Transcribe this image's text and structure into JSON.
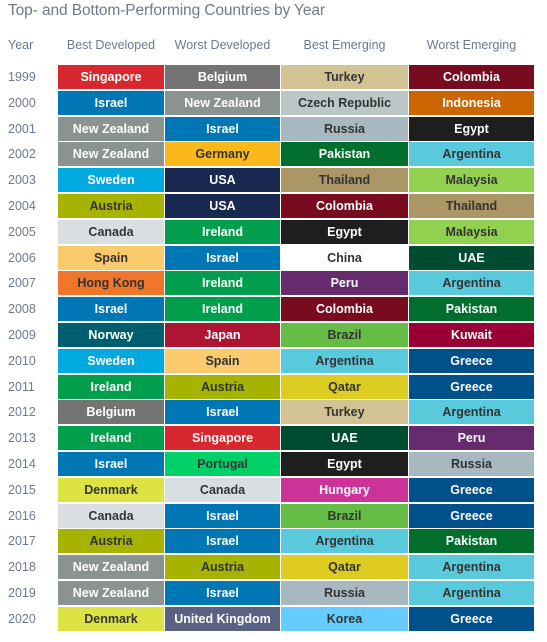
{
  "title": "Top- and Bottom-Performing Countries by Year",
  "headers": [
    "Year",
    "Best Developed",
    "Worst Developed",
    "Best Emerging",
    "Worst Emerging"
  ],
  "country_colors": {
    "Singapore": {
      "bg": "#d8282f",
      "fg": "#ffffff"
    },
    "Belgium": {
      "bg": "#747474",
      "fg": "#ffffff"
    },
    "Turkey": {
      "bg": "#d1c393",
      "fg": "#333333"
    },
    "Colombia": {
      "bg": "#780c1e",
      "fg": "#ffffff"
    },
    "Israel": {
      "bg": "#0077b5",
      "fg": "#ffffff"
    },
    "New Zealand": {
      "bg": "#8a9391",
      "fg": "#ffffff"
    },
    "Czech Republic": {
      "bg": "#b9c7c6",
      "fg": "#333333"
    },
    "Indonesia": {
      "bg": "#cc6600",
      "fg": "#ffffff"
    },
    "Russia": {
      "bg": "#a8b8c1",
      "fg": "#333333"
    },
    "Egypt": {
      "bg": "#1e1e1e",
      "fg": "#ffffff"
    },
    "Germany": {
      "bg": "#fbb81b",
      "fg": "#333333"
    },
    "Pakistan": {
      "bg": "#006f2e",
      "fg": "#ffffff"
    },
    "Argentina": {
      "bg": "#59c9dc",
      "fg": "#333333"
    },
    "Sweden": {
      "bg": "#00a9e0",
      "fg": "#ffffff"
    },
    "USA": {
      "bg": "#18284f",
      "fg": "#ffffff"
    },
    "Thailand": {
      "bg": "#ab9666",
      "fg": "#333333"
    },
    "Malaysia": {
      "bg": "#92d050",
      "fg": "#333333"
    },
    "Austria": {
      "bg": "#a6b300",
      "fg": "#333333"
    },
    "Canada": {
      "bg": "#d9dfe0",
      "fg": "#333333"
    },
    "Ireland": {
      "bg": "#009e4d",
      "fg": "#ffffff"
    },
    "Spain": {
      "bg": "#f9cb6c",
      "fg": "#333333"
    },
    "China": {
      "bg": "#ffffff",
      "fg": "#333333"
    },
    "UAE": {
      "bg": "#004c31",
      "fg": "#ffffff"
    },
    "Hong Kong": {
      "bg": "#ef762a",
      "fg": "#333333"
    },
    "Peru": {
      "bg": "#652b6d",
      "fg": "#ffffff"
    },
    "Norway": {
      "bg": "#005f6e",
      "fg": "#ffffff"
    },
    "Japan": {
      "bg": "#ad1530",
      "fg": "#ffffff"
    },
    "Brazil": {
      "bg": "#66bd45",
      "fg": "#333333"
    },
    "Kuwait": {
      "bg": "#990033",
      "fg": "#ffffff"
    },
    "Greece": {
      "bg": "#00508c",
      "fg": "#ffffff"
    },
    "Qatar": {
      "bg": "#ddcc22",
      "fg": "#333333"
    },
    "Portugal": {
      "bg": "#00d068",
      "fg": "#333333"
    },
    "Denmark": {
      "bg": "#dde343",
      "fg": "#333333"
    },
    "Hungary": {
      "bg": "#cc3399",
      "fg": "#ffffff"
    },
    "United Kingdom": {
      "bg": "#5a6283",
      "fg": "#ffffff"
    },
    "Korea": {
      "bg": "#66ccff",
      "fg": "#333333"
    }
  },
  "rows": [
    {
      "year": "1999",
      "cells": [
        "Singapore",
        "Belgium",
        "Turkey",
        "Colombia"
      ]
    },
    {
      "year": "2000",
      "cells": [
        "Israel",
        "New Zealand",
        "Czech Republic",
        "Indonesia"
      ]
    },
    {
      "year": "2001",
      "cells": [
        "New Zealand",
        "Israel",
        "Russia",
        "Egypt"
      ]
    },
    {
      "year": "2002",
      "cells": [
        "New Zealand",
        "Germany",
        "Pakistan",
        "Argentina"
      ]
    },
    {
      "year": "2003",
      "cells": [
        "Sweden",
        "USA",
        "Thailand",
        "Malaysia"
      ]
    },
    {
      "year": "2004",
      "cells": [
        "Austria",
        "USA",
        "Colombia",
        "Thailand"
      ]
    },
    {
      "year": "2005",
      "cells": [
        "Canada",
        "Ireland",
        "Egypt",
        "Malaysia"
      ]
    },
    {
      "year": "2006",
      "cells": [
        "Spain",
        "Israel",
        "China",
        "UAE"
      ]
    },
    {
      "year": "2007",
      "cells": [
        "Hong Kong",
        "Ireland",
        "Peru",
        "Argentina"
      ]
    },
    {
      "year": "2008",
      "cells": [
        "Israel",
        "Ireland",
        "Colombia",
        "Pakistan"
      ]
    },
    {
      "year": "2009",
      "cells": [
        "Norway",
        "Japan",
        "Brazil",
        "Kuwait"
      ]
    },
    {
      "year": "2010",
      "cells": [
        "Sweden",
        "Spain",
        "Argentina",
        "Greece"
      ]
    },
    {
      "year": "2011",
      "cells": [
        "Ireland",
        "Austria",
        "Qatar",
        "Greece"
      ]
    },
    {
      "year": "2012",
      "cells": [
        "Belgium",
        "Israel",
        "Turkey",
        "Argentina"
      ]
    },
    {
      "year": "2013",
      "cells": [
        "Ireland",
        "Singapore",
        "UAE",
        "Peru"
      ]
    },
    {
      "year": "2014",
      "cells": [
        "Israel",
        "Portugal",
        "Egypt",
        "Russia"
      ]
    },
    {
      "year": "2015",
      "cells": [
        "Denmark",
        "Canada",
        "Hungary",
        "Greece"
      ]
    },
    {
      "year": "2016",
      "cells": [
        "Canada",
        "Israel",
        "Brazil",
        "Greece"
      ]
    },
    {
      "year": "2017",
      "cells": [
        "Austria",
        "Israel",
        "Argentina",
        "Pakistan"
      ]
    },
    {
      "year": "2018",
      "cells": [
        "New Zealand",
        "Austria",
        "Qatar",
        "Argentina"
      ]
    },
    {
      "year": "2019",
      "cells": [
        "New Zealand",
        "Israel",
        "Russia",
        "Argentina"
      ]
    },
    {
      "year": "2020",
      "cells": [
        "Denmark",
        "United Kingdom",
        "Korea",
        "Greece"
      ]
    }
  ]
}
